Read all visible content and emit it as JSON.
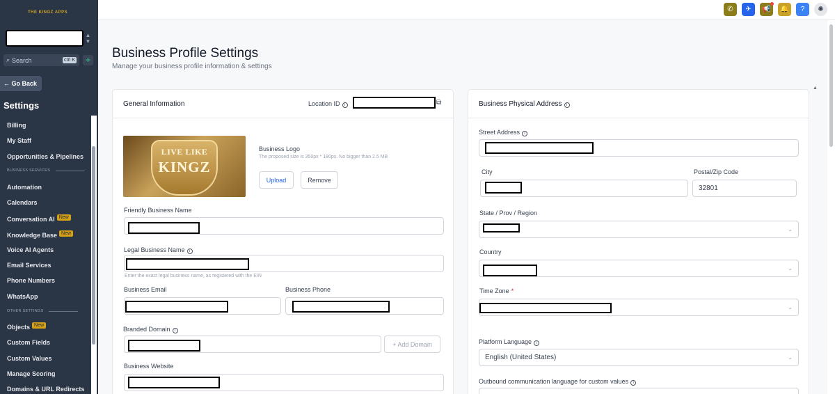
{
  "sidebar": {
    "brand": "THE KINGZ APPS",
    "search_label": "Search",
    "search_shortcut": "ctrl K",
    "add_label": "+",
    "go_back": "← Go Back",
    "title": "Settings",
    "items": [
      {
        "label": "Billing"
      },
      {
        "label": "My Staff"
      },
      {
        "label": "Opportunities & Pipelines"
      },
      {
        "section": "BUSINESS SERVICES"
      },
      {
        "label": "Automation"
      },
      {
        "label": "Calendars"
      },
      {
        "label": "Conversation AI",
        "badge": "New"
      },
      {
        "label": "Knowledge Base",
        "badge": "New"
      },
      {
        "label": "Voice AI Agents"
      },
      {
        "label": "Email Services"
      },
      {
        "label": "Phone Numbers"
      },
      {
        "label": "WhatsApp"
      },
      {
        "section": "OTHER SETTINGS"
      },
      {
        "label": "Objects",
        "badge": "New"
      },
      {
        "label": "Custom Fields"
      },
      {
        "label": "Custom Values"
      },
      {
        "label": "Manage Scoring"
      },
      {
        "label": "Domains & URL Redirects"
      }
    ]
  },
  "topbar": {
    "icons": [
      {
        "name": "phone-icon",
        "glyph": "✆",
        "color": "#8b7d1a"
      },
      {
        "name": "rocket-icon",
        "glyph": "✈",
        "color": "#2563eb"
      },
      {
        "name": "megaphone-icon",
        "glyph": "📢",
        "color": "#8b7d1a"
      },
      {
        "name": "bell-icon",
        "glyph": "🔔",
        "color": "#c9a227"
      },
      {
        "name": "help-icon",
        "glyph": "?",
        "color": "#3b82f6"
      }
    ]
  },
  "page": {
    "title": "Business Profile Settings",
    "subtitle": "Manage your business profile information & settings"
  },
  "general": {
    "title": "General Information",
    "location_id_label": "Location ID",
    "logo_title": "Business Logo",
    "logo_hint": "The proposed size is 350px * 180px. No bigger than 2.5 MB",
    "logo_text_1": "LIVE LIKE",
    "logo_text_2": "KINGZ",
    "upload": "Upload",
    "remove": "Remove",
    "friendly_name_label": "Friendly Business Name",
    "legal_name_label": "Legal Business Name",
    "legal_name_hint": "Enter the exact legal business name, as registered with the EIN",
    "email_label": "Business Email",
    "phone_label": "Business Phone",
    "branded_domain_label": "Branded Domain",
    "add_domain": "+ Add Domain",
    "website_label": "Business Website"
  },
  "address": {
    "title": "Business Physical Address",
    "street_label": "Street Address",
    "city_label": "City",
    "zip_label": "Postal/Zip Code",
    "zip_value": "32801",
    "state_label": "State / Prov / Region",
    "country_label": "Country",
    "timezone_label": "Time Zone",
    "timezone_required": "*",
    "platform_language_label": "Platform Language",
    "platform_language_value": "English (United States)",
    "outbound_language_label": "Outbound communication language for custom values"
  }
}
